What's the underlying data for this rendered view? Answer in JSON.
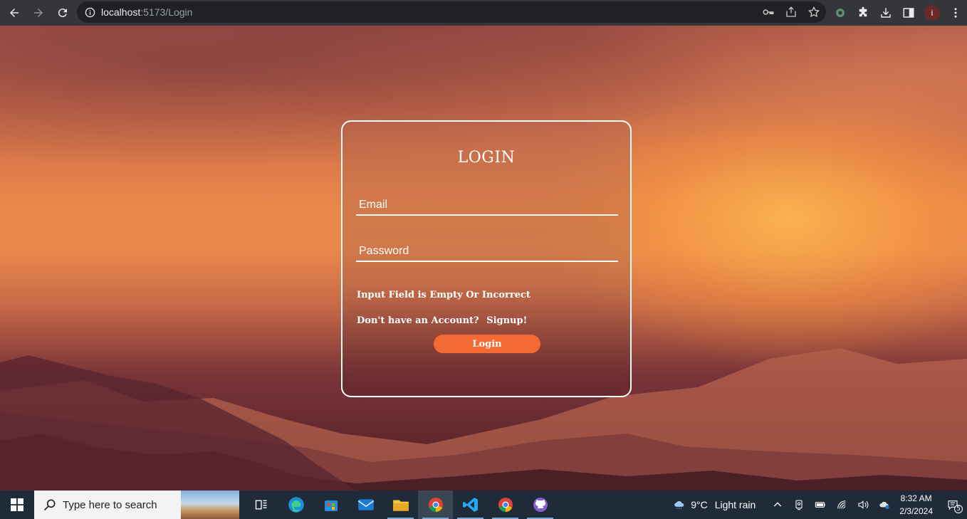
{
  "browser": {
    "url_host": "localhost",
    "url_path": ":5173/Login",
    "avatar_letter": "i"
  },
  "login": {
    "title": "LOGIN",
    "email_placeholder": "Email",
    "password_placeholder": "Password",
    "error_message": "Input Field is Empty Or Incorrect",
    "signup_prompt": "Don't have an Account?",
    "signup_link": "Signup!",
    "login_button": "Login"
  },
  "taskbar": {
    "search_placeholder": "Type here to search",
    "weather_temp": "9°C",
    "weather_condition": "Light rain",
    "time": "8:32 AM",
    "date": "2/3/2024",
    "notification_count": "5"
  },
  "colors": {
    "accent": "#f36a32",
    "taskbar_bg": "#1f2b38",
    "chrome_bg": "#35363a"
  }
}
